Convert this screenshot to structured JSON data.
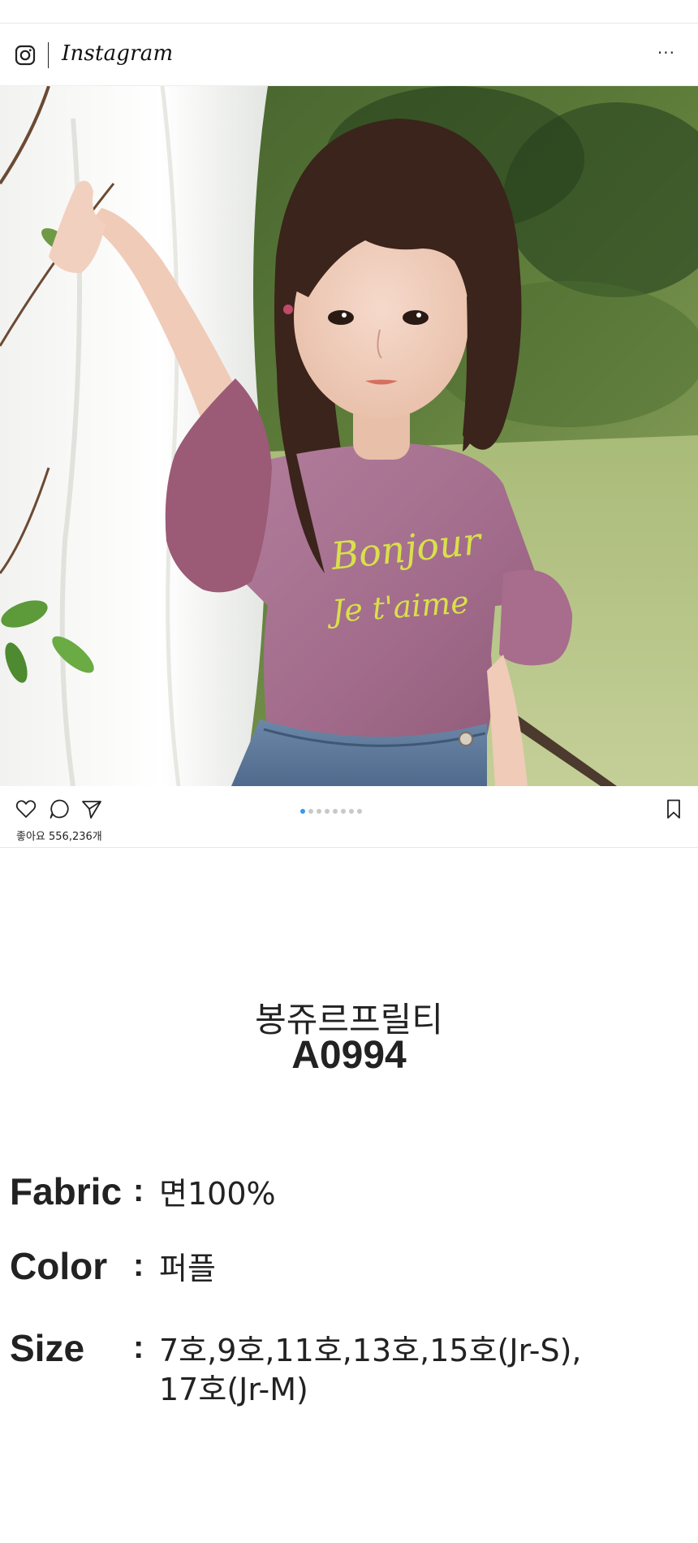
{
  "post": {
    "platform_name": "Instagram",
    "more_label": "···",
    "likes_text": "좋아요 556,236개",
    "carousel": {
      "total": 8,
      "active_index": 0
    },
    "accent_color": "#3897f0"
  },
  "product": {
    "name": "봉쥬르프릴티",
    "code": "A0994",
    "shirt_text_line1": "Bonjour",
    "shirt_text_line2": "Je t'aime",
    "specs": {
      "fabric": {
        "label": "Fabric",
        "colon": ":",
        "value": "면100%"
      },
      "color": {
        "label": "Color",
        "colon": ":",
        "value": "퍼플"
      },
      "size": {
        "label": "Size",
        "colon": ":",
        "value_line1": "7호,9호,11호,13호,15호(Jr-S),",
        "value_line2": "17호(Jr-M)"
      }
    }
  }
}
